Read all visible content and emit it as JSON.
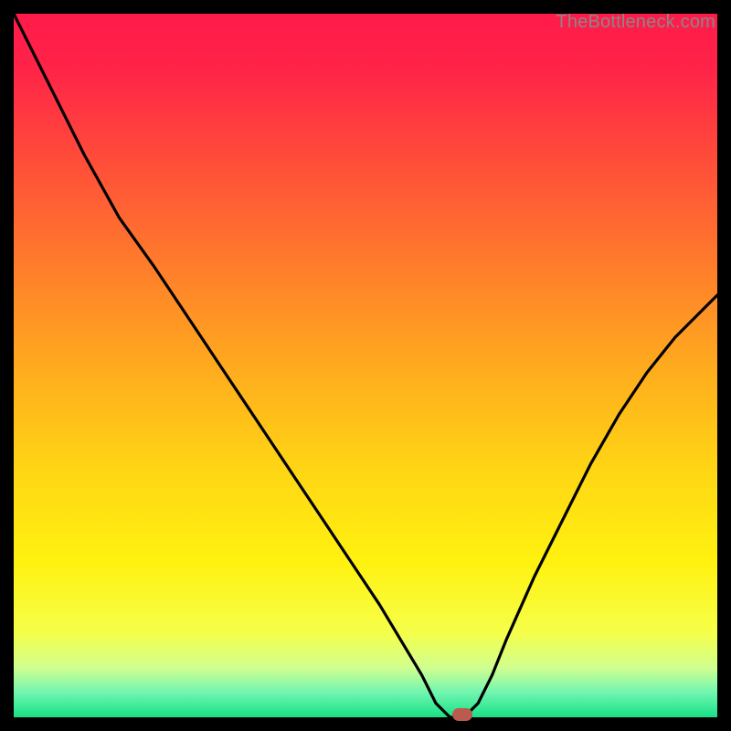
{
  "watermark": "TheBottleneck.com",
  "chart_data": {
    "type": "line",
    "title": "",
    "xlabel": "",
    "ylabel": "",
    "x": [
      0.0,
      0.05,
      0.1,
      0.15,
      0.2,
      0.24,
      0.28,
      0.32,
      0.36,
      0.4,
      0.44,
      0.48,
      0.52,
      0.55,
      0.58,
      0.6,
      0.62,
      0.64,
      0.66,
      0.68,
      0.7,
      0.74,
      0.78,
      0.82,
      0.86,
      0.9,
      0.94,
      0.98,
      1.0
    ],
    "values": [
      1.0,
      0.9,
      0.8,
      0.71,
      0.64,
      0.58,
      0.52,
      0.46,
      0.4,
      0.34,
      0.28,
      0.22,
      0.16,
      0.11,
      0.06,
      0.02,
      0.0,
      0.0,
      0.02,
      0.06,
      0.11,
      0.2,
      0.28,
      0.36,
      0.43,
      0.49,
      0.54,
      0.58,
      0.6
    ],
    "background_gradient": {
      "stops": [
        {
          "offset": 0.0,
          "color": "#ff1a4a"
        },
        {
          "offset": 0.08,
          "color": "#ff2448"
        },
        {
          "offset": 0.2,
          "color": "#ff4a3a"
        },
        {
          "offset": 0.35,
          "color": "#ff7a2c"
        },
        {
          "offset": 0.5,
          "color": "#ffaa1e"
        },
        {
          "offset": 0.65,
          "color": "#ffd614"
        },
        {
          "offset": 0.78,
          "color": "#fff210"
        },
        {
          "offset": 0.88,
          "color": "#f5ff4a"
        },
        {
          "offset": 0.93,
          "color": "#d0ff90"
        },
        {
          "offset": 0.965,
          "color": "#70f5b0"
        },
        {
          "offset": 1.0,
          "color": "#18e085"
        }
      ]
    },
    "marker": {
      "x": 0.638,
      "y": 0.004,
      "color": "#bb5a4e"
    },
    "xlim": [
      0,
      1
    ],
    "ylim": [
      0,
      1
    ],
    "grid": false,
    "legend": false
  }
}
